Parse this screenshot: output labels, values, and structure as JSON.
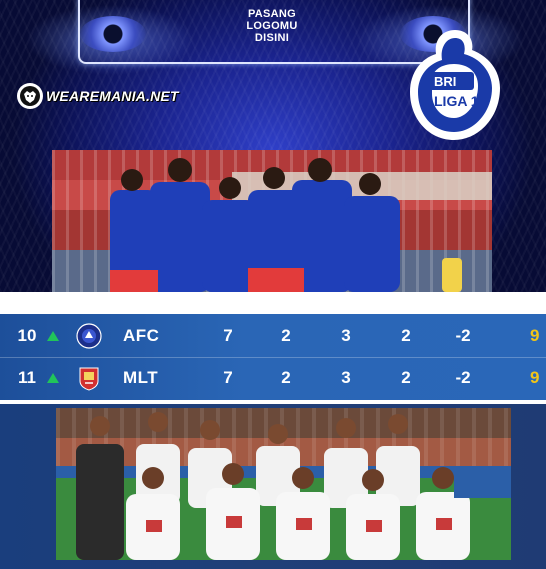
{
  "banner": {
    "logo_placeholder": [
      "PASANG",
      "LOGOMU",
      "DISINI"
    ],
    "watermark": "WEAREMANIA.NET",
    "league_logo_text": [
      "BRI",
      "LIGA 1"
    ]
  },
  "colors": {
    "banner_blue": "#1b2490",
    "standings_blue": "#2a66b6",
    "points_yellow": "#f0c419",
    "up_arrow_green": "#21c45a"
  },
  "standings": {
    "rows": [
      {
        "rank": "10",
        "trend": "up",
        "badge": "arema-badge",
        "team": "AFC",
        "played": "7",
        "won": "2",
        "drawn": "3",
        "lost": "2",
        "goal_diff": "-2",
        "points": "9"
      },
      {
        "rank": "11",
        "trend": "up",
        "badge": "malut-badge",
        "team": "MLT",
        "played": "7",
        "won": "2",
        "drawn": "3",
        "lost": "2",
        "goal_diff": "-2",
        "points": "9"
      }
    ]
  }
}
